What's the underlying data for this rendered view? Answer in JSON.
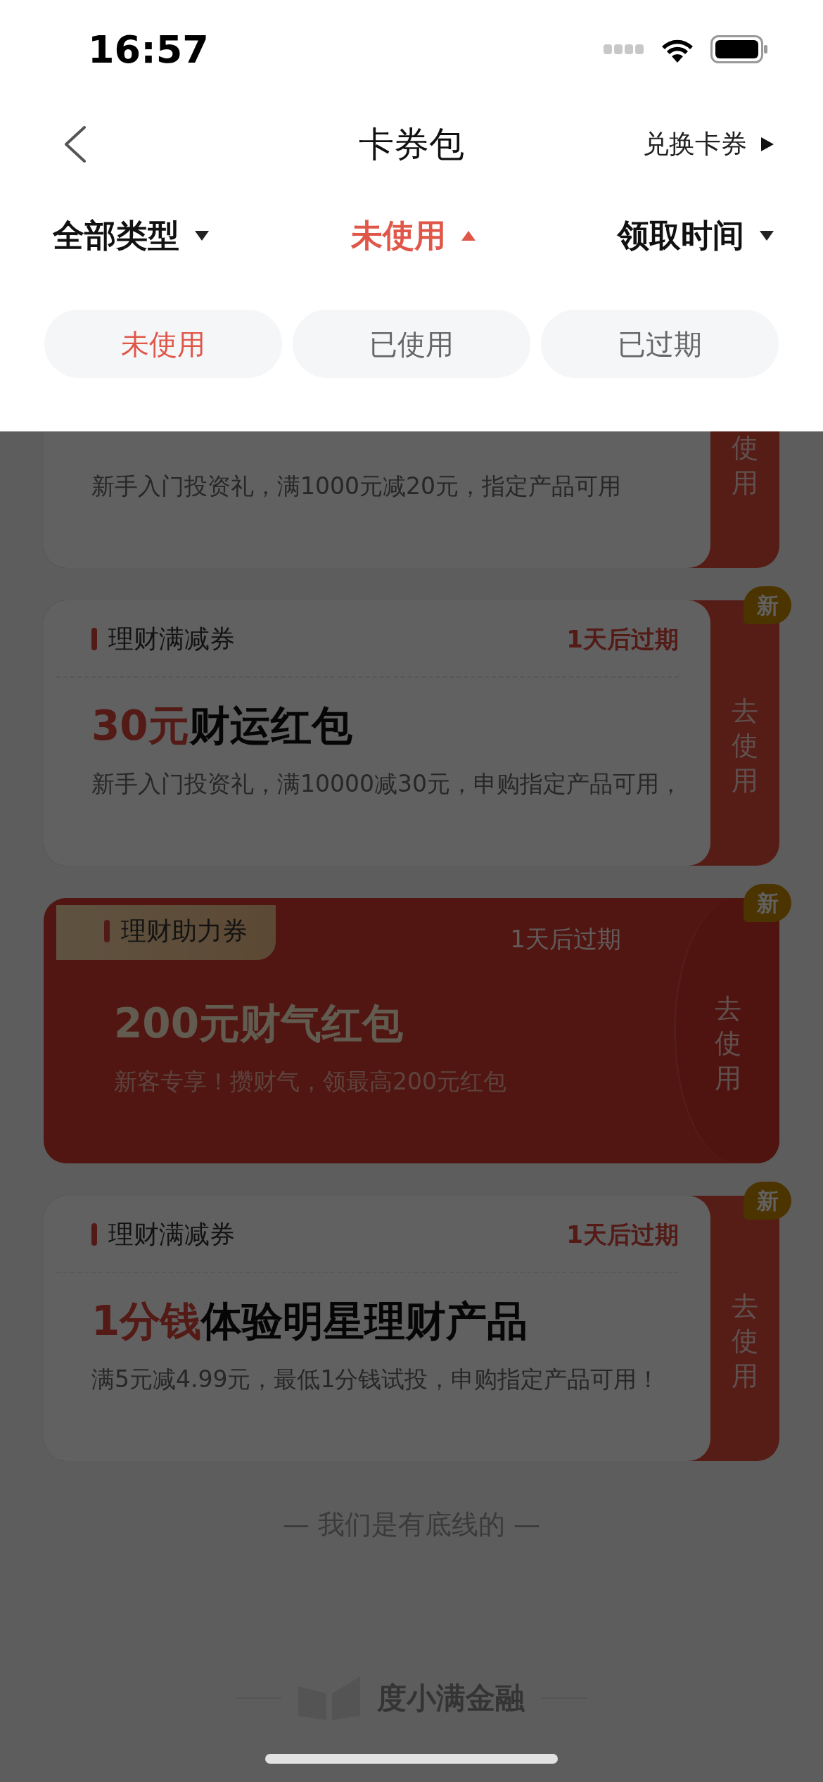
{
  "status_bar": {
    "time": "16:57"
  },
  "header": {
    "title": "卡券包",
    "action": "兑换卡券"
  },
  "filters": [
    {
      "label": "全部类型",
      "expanded": false
    },
    {
      "label": "未使用",
      "expanded": true
    },
    {
      "label": "领取时间",
      "expanded": false
    }
  ],
  "status_options": [
    {
      "label": "未使用",
      "selected": true
    },
    {
      "label": "已使用",
      "selected": false
    },
    {
      "label": "已过期",
      "selected": false
    }
  ],
  "coupons": [
    {
      "kind": "standard",
      "description": "新手入门投资礼，满1000元减20元，指定产品可用",
      "action": "使用"
    },
    {
      "kind": "standard",
      "tag": "理财满减券",
      "expiry": "1天后过期",
      "amount": "30元",
      "name": "财运红包",
      "description": "新手入门投资礼，满10000减30元，申购指定产品可用，",
      "action": "去使用",
      "badge": "新"
    },
    {
      "kind": "promo",
      "tag": "理财助力券",
      "expiry": "1天后过期",
      "amount": "200元",
      "name": "财气红包",
      "description": "新客专享！攒财气，领最高200元红包",
      "action": "去使用",
      "badge": "新"
    },
    {
      "kind": "standard",
      "tag": "理财满减券",
      "expiry": "1天后过期",
      "amount": "1分钱",
      "name": "体验明星理财产品",
      "description": "满5元减4.99元，最低1分钱试投，申购指定产品可用！",
      "action": "去使用",
      "badge": "新"
    }
  ],
  "footer": {
    "note": "— 我们是有底线的 —",
    "brand": "度小满金融"
  }
}
